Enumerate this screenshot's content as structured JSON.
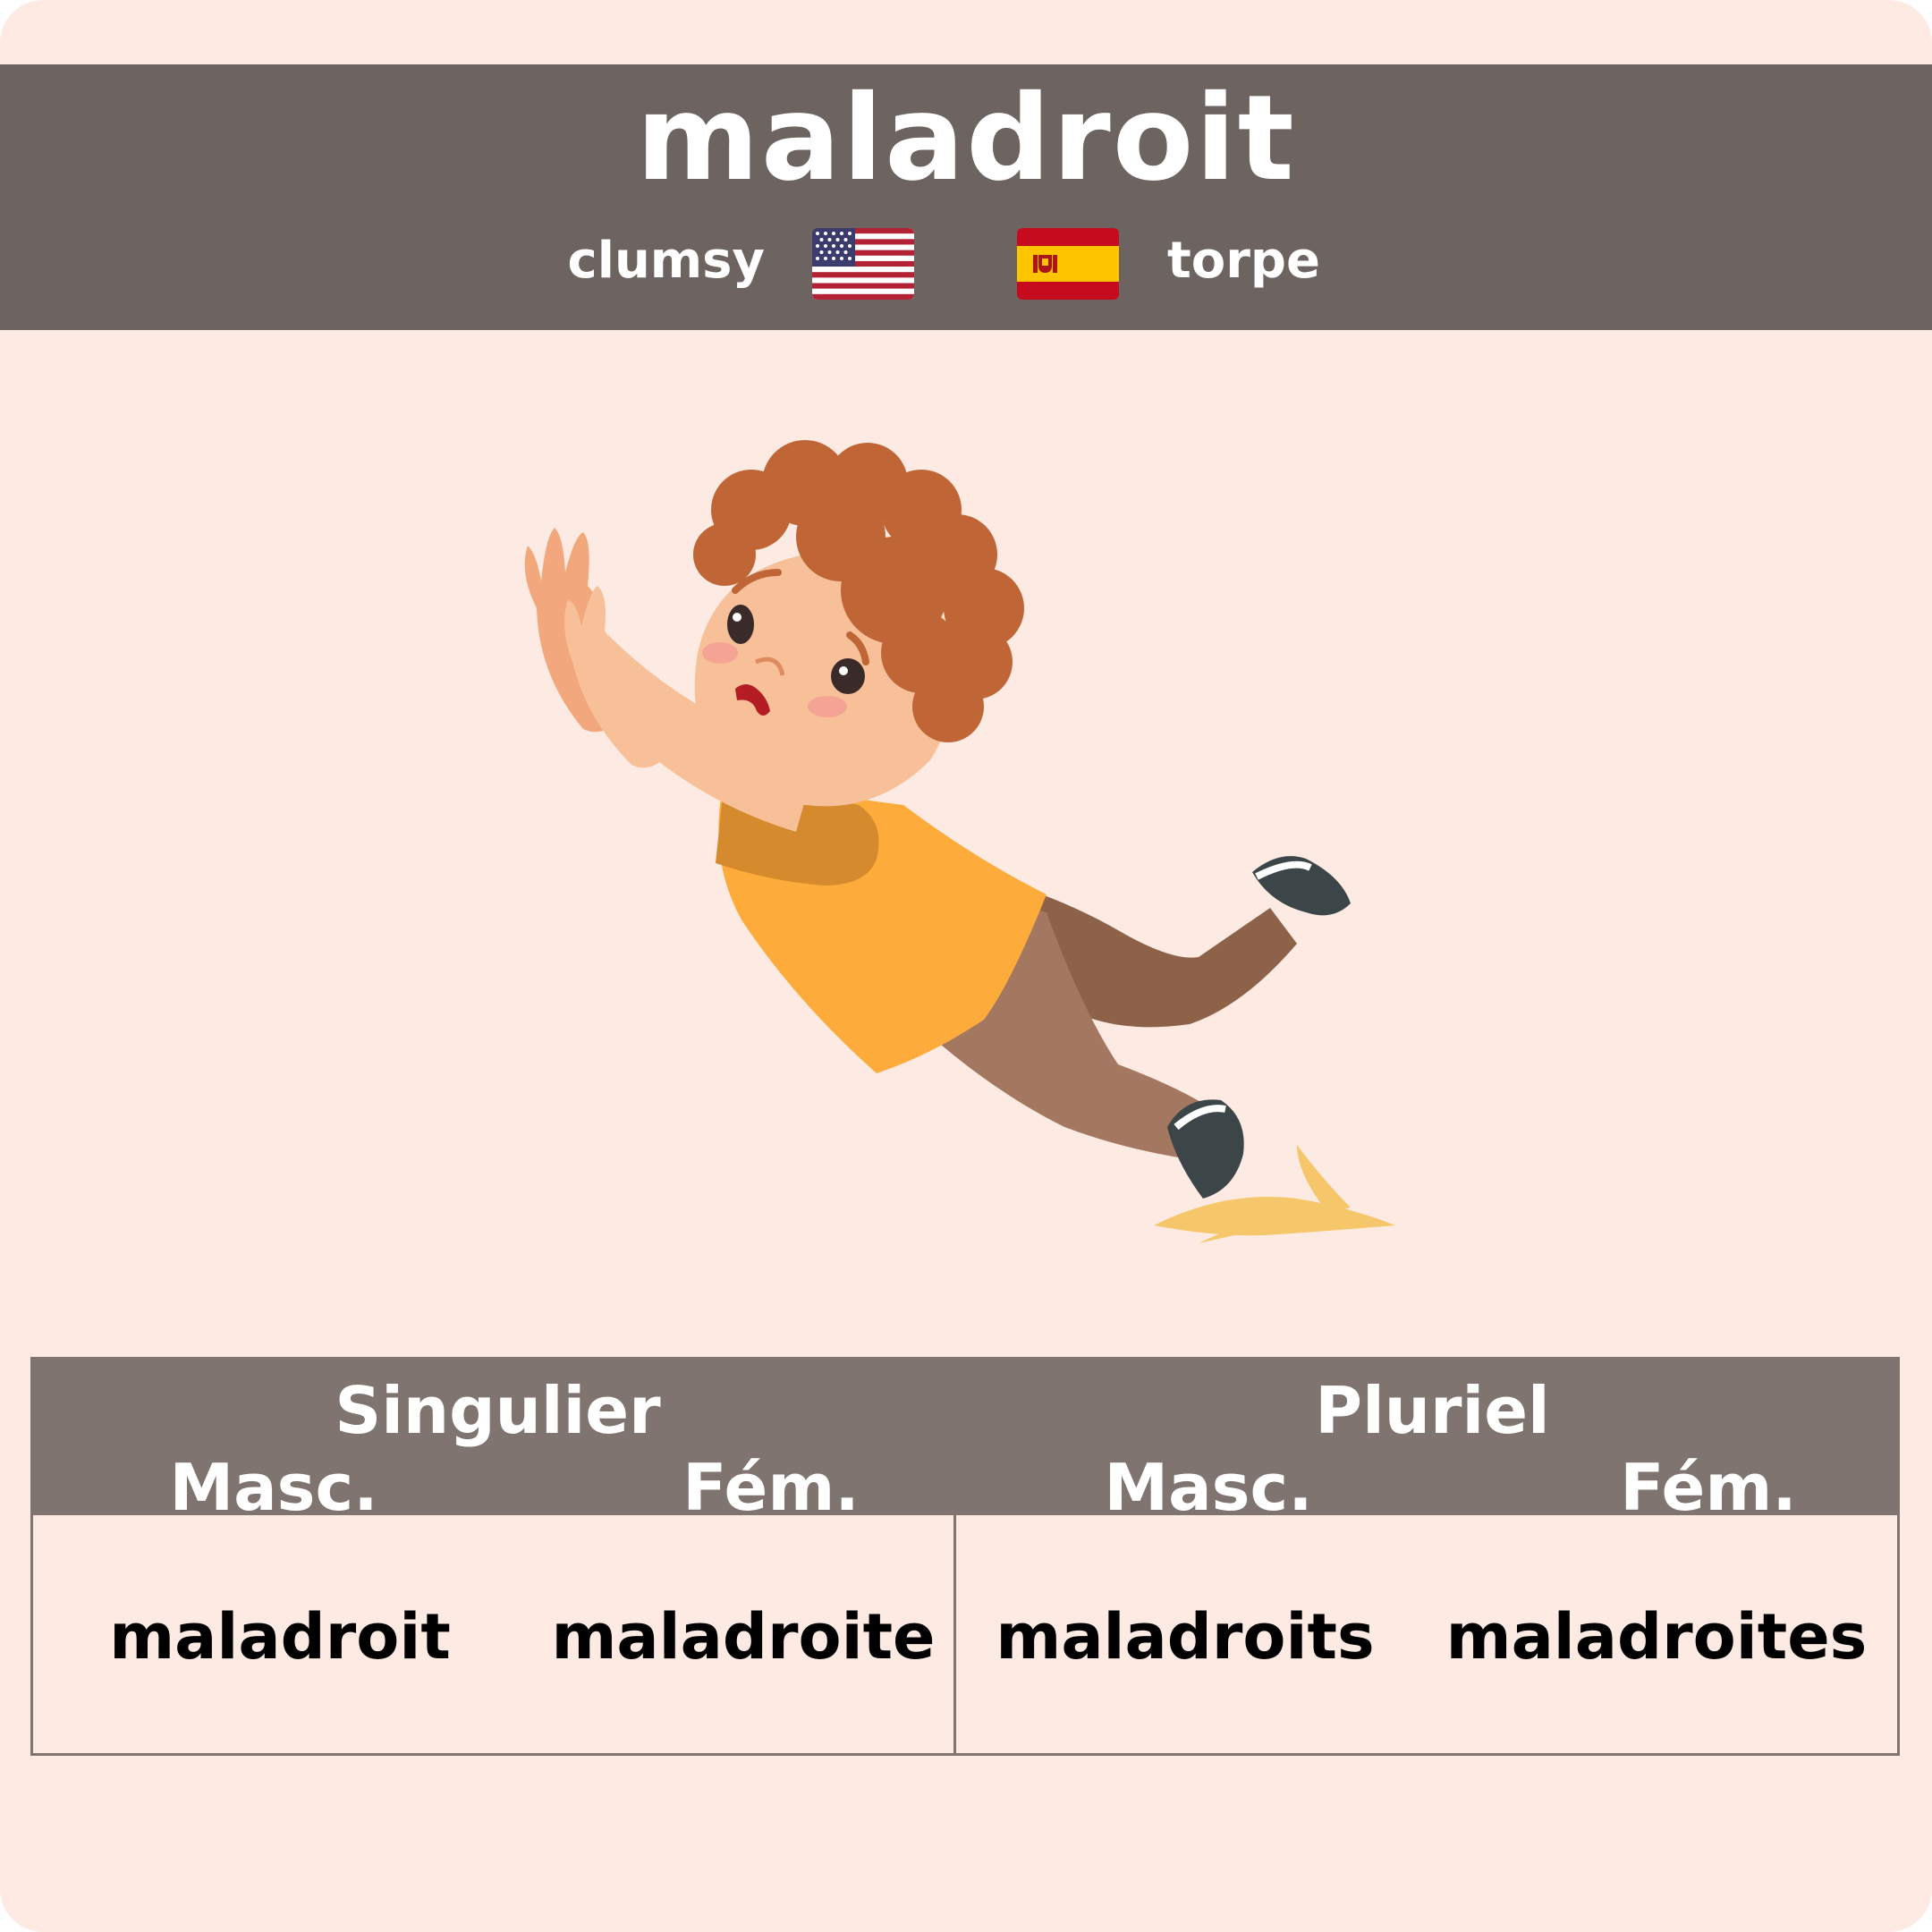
{
  "header": {
    "word": "maladroit",
    "english": "clumsy",
    "spanish": "torpe"
  },
  "flags": [
    "us-flag-icon",
    "spain-flag-icon"
  ],
  "illustration": "boy-slipping-on-banana-peel-icon",
  "table": {
    "groups": [
      "Singulier",
      "Pluriel"
    ],
    "columns": [
      "Masc.",
      "Fém.",
      "Masc.",
      "Fém."
    ],
    "forms": [
      "maladroit",
      "maladroite",
      "maladroits",
      "maladroites"
    ]
  },
  "colors": {
    "background": "#fdebe3",
    "header": "#6d6461",
    "table_header": "#7f7470"
  }
}
